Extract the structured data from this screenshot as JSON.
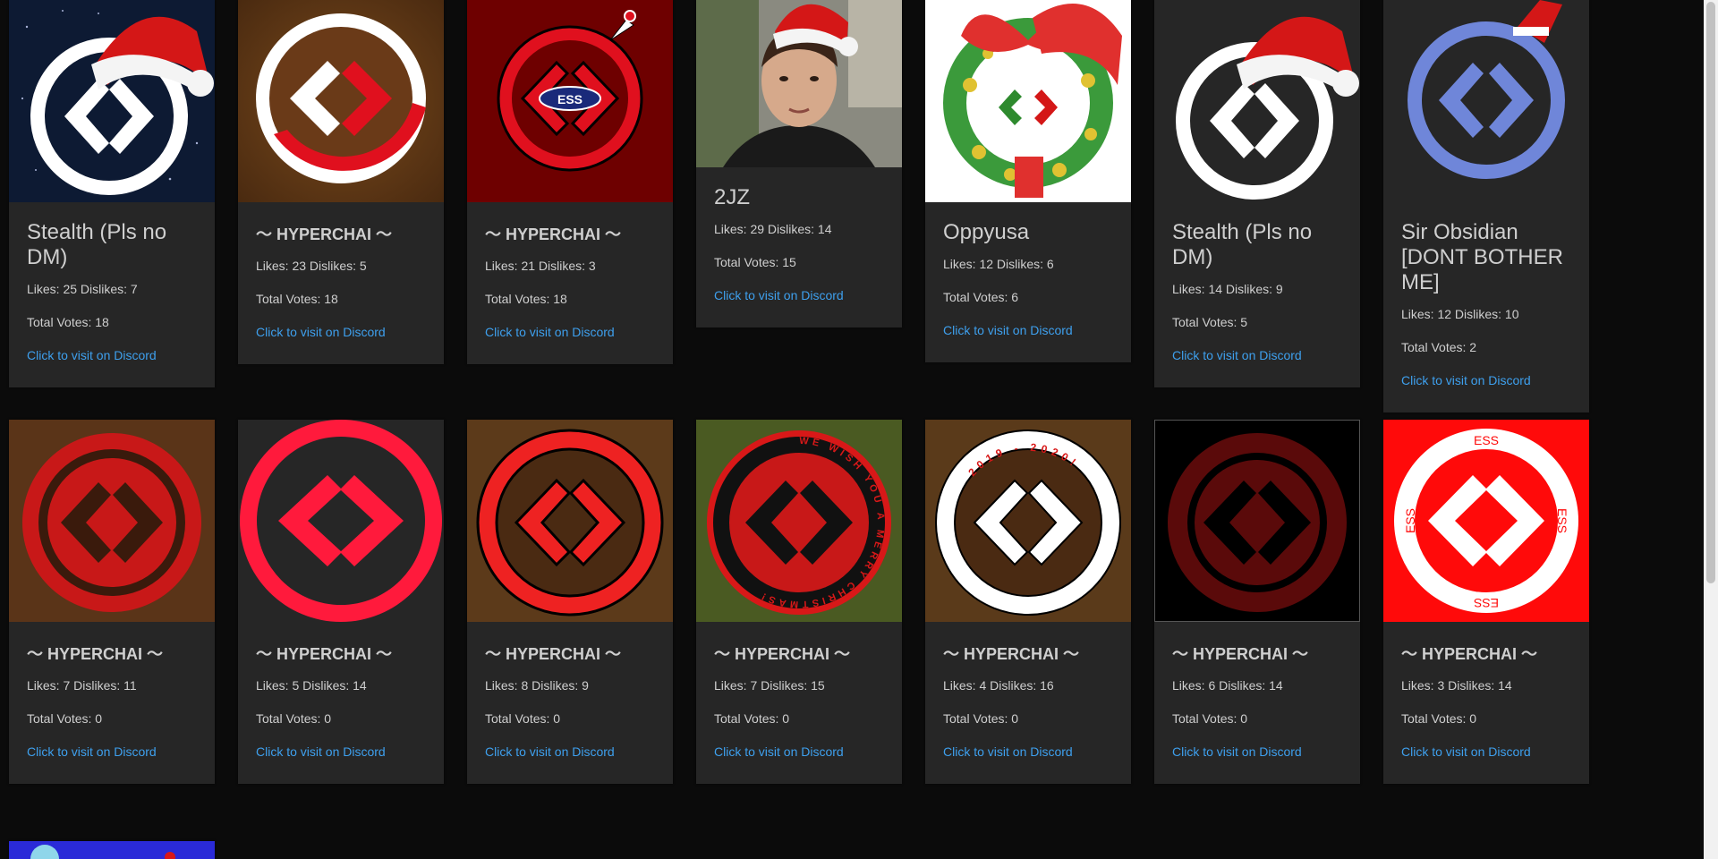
{
  "cards": [
    {
      "name": "Stealth (Pls no DM)",
      "likes": "Likes: 25 Dislikes: 7",
      "votes": "Total Votes: 18",
      "link": "Click to visit on Discord",
      "icon": "santa-hat-logo-icon"
    },
    {
      "name": "～ HYPERCHAI ～",
      "likes": "Likes: 23 Dislikes: 5",
      "votes": "Total Votes: 18",
      "link": "Click to visit on Discord",
      "icon": "striped-logo-icon"
    },
    {
      "name": "～ HYPERCHAI ～",
      "likes": "Likes: 21 Dislikes: 3",
      "votes": "Total Votes: 18",
      "link": "Click to visit on Discord",
      "icon": "ornament-logo-icon",
      "ess": "ESS"
    },
    {
      "name": "2JZ",
      "likes": "Likes: 29 Dislikes: 14",
      "votes": "Total Votes: 15",
      "link": "Click to visit on Discord",
      "icon": "person-photo-icon"
    },
    {
      "name": "Oppyusa",
      "likes": "Likes: 12 Dislikes: 6",
      "votes": "Total Votes: 6",
      "link": "Click to visit on Discord",
      "icon": "wreath-logo-icon"
    },
    {
      "name": "Stealth (Pls no DM)",
      "likes": "Likes: 14 Dislikes: 9",
      "votes": "Total Votes: 5",
      "link": "Click to visit on Discord",
      "icon": "santa-hat-logo-icon"
    },
    {
      "name": "Sir Obsidian [DONT BOTHER ME]",
      "likes": "Likes: 12 Dislikes: 10",
      "votes": "Total Votes: 2",
      "link": "Click to visit on Discord",
      "icon": "pixel-logo-icon"
    },
    {
      "name": "～ HYPERCHAI ～",
      "likes": "Likes: 7 Dislikes: 11",
      "votes": "Total Votes: 0",
      "link": "Click to visit on Discord",
      "icon": "glitter-logo-icon"
    },
    {
      "name": "～ HYPERCHAI ～",
      "likes": "Likes: 5 Dislikes: 14",
      "votes": "Total Votes: 0",
      "link": "Click to visit on Discord",
      "icon": "red-logo-icon"
    },
    {
      "name": "～ HYPERCHAI ～",
      "likes": "Likes: 8 Dislikes: 9",
      "votes": "Total Votes: 0",
      "link": "Click to visit on Discord",
      "icon": "red-ring-logo-icon"
    },
    {
      "name": "～ HYPERCHAI ～",
      "likes": "Likes: 7 Dislikes: 15",
      "votes": "Total Votes: 0",
      "link": "Click to visit on Discord",
      "icon": "christmas-text-logo-icon",
      "ring_text": "WE WISH YOU A MERRY CHRISTMAS!"
    },
    {
      "name": "～ HYPERCHAI ～",
      "likes": "Likes: 4 Dislikes: 16",
      "votes": "Total Votes: 0",
      "link": "Click to visit on Discord",
      "icon": "white-ring-logo-icon",
      "ring_text": "2019 - 2020!"
    },
    {
      "name": "～ HYPERCHAI ～",
      "likes": "Likes: 6 Dislikes: 14",
      "votes": "Total Votes: 0",
      "link": "Click to visit on Discord",
      "icon": "dark-text-logo-icon"
    },
    {
      "name": "～ HYPERCHAI ～",
      "likes": "Likes: 3 Dislikes: 14",
      "votes": "Total Votes: 0",
      "link": "Click to visit on Discord",
      "icon": "ess-logo-icon",
      "ess": "ESS"
    }
  ],
  "colors": {
    "background": "#0b0b0b",
    "card": "#262626",
    "link": "#3ea0ee",
    "text": "#cfcfcf",
    "accent_red": "#e5102a"
  }
}
